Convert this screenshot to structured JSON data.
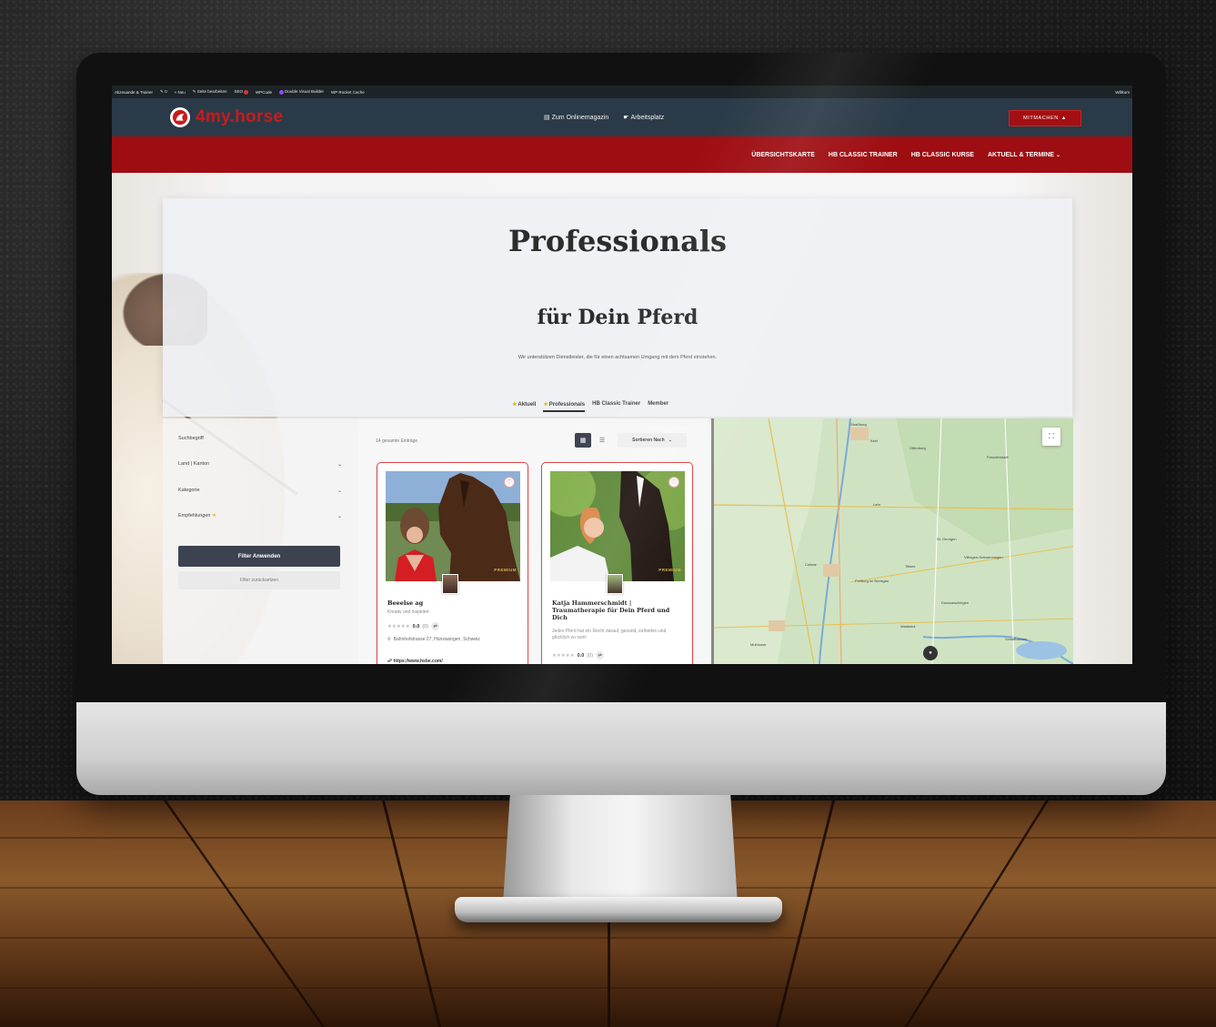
{
  "admin_bar": {
    "site": "Akzeuande & Trainer",
    "comments": "0",
    "new": "+ Neu",
    "edit_page": "Seite bearbeiten",
    "seo": "SEO",
    "wpcode": "WPCode",
    "dvb": "Double Visual Builder",
    "cache": "WP Rocket Cache",
    "welcome": "Willkom"
  },
  "header": {
    "logo_text": "4my.horse",
    "links": [
      {
        "icon": "magazine-icon",
        "label": "Zum Onlinemagazin"
      },
      {
        "icon": "workspace-icon",
        "label": "Arbeitsplatz"
      }
    ],
    "join_button": "Mitmachen"
  },
  "main_nav": {
    "items": [
      "ÜBERSICHTSKARTE",
      "HB CLASSIC TRAINER",
      "HB CLASSIC KURSE",
      "AKTUELL & TERMINE"
    ]
  },
  "hero": {
    "title": "Professionals",
    "subtitle": "für Dein Pferd",
    "description": "Wir unterstützen Dienstleister, die für einen achtsamen Umgang mit dem Pferd einstehen."
  },
  "tabs": [
    {
      "label": "Aktuell",
      "star": true,
      "active": false
    },
    {
      "label": "Professionals",
      "star": true,
      "active": true
    },
    {
      "label": "HB Classic Trainer",
      "star": false,
      "active": false
    },
    {
      "label": "Member",
      "star": false,
      "active": false
    }
  ],
  "filters": {
    "search_label": "Suchbegriff",
    "country_label": "Land | Kanton",
    "category_label": "Kategorie",
    "recommendations_label": "Empfehlungen",
    "apply_button": "Filter Anwenden",
    "reset_button": "Filter zurücksetzen"
  },
  "results": {
    "count_text": "14 gesamte Einträge",
    "sort_label": "Sortieren Nach",
    "cards": [
      {
        "title": "Beeelse ag",
        "subtitle": "Kreativ und inspiriert",
        "rating": "0.0",
        "reviews": "(0)",
        "badge": "PREMIUM",
        "address": "Bahnhofstrasse 27, Hünxwangen, Schweiz",
        "link": "https://www.hsbe.com/"
      },
      {
        "title": "Katja Hammerschmidt | Traumatherapie für Dein Pferd und Dich",
        "subtitle": "Jedes Pferd hat ein Recht darauf, gesund, zufrieden und glücklich zu sein!",
        "rating": "0.0",
        "reviews": "(0)",
        "badge": "PREMIUM"
      }
    ]
  },
  "map": {
    "labels": [
      "Straßburg",
      "Offenburg",
      "Freudenstadt",
      "Kehl",
      "Lahr",
      "Colmar",
      "Freiburg im Breisgau",
      "Titisee",
      "Villingen-Schwenningen",
      "Donaueschingen",
      "St. Georgen",
      "Mulhouse",
      "Waldshut",
      "Schaffhausen"
    ]
  },
  "colors": {
    "topbar": "#2b3a48",
    "brand_red": "#9e0d12",
    "logo_red": "#c91b1b",
    "star": "#f0b400"
  }
}
